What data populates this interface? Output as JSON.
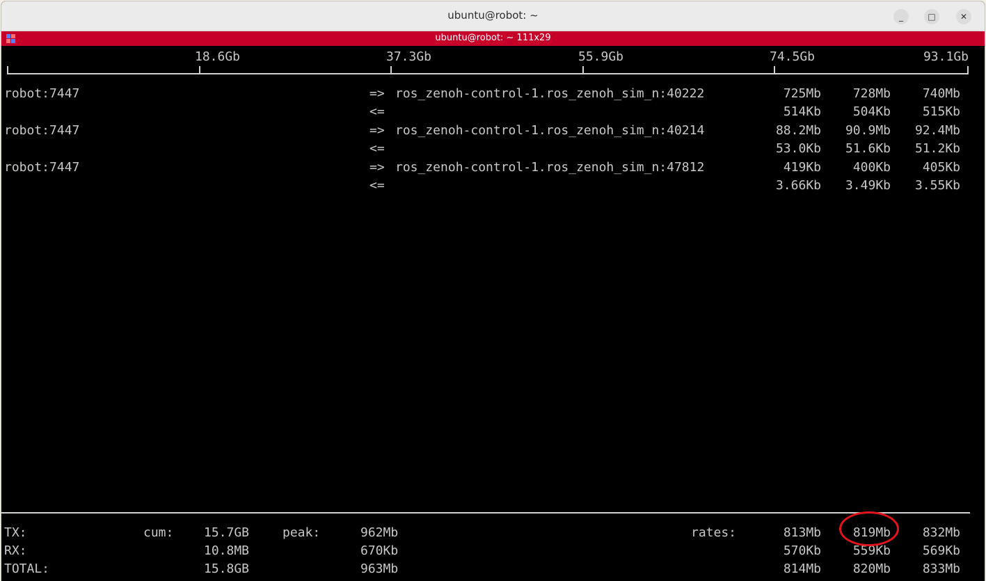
{
  "window": {
    "title": "ubuntu@robot: ~"
  },
  "tab": {
    "title": "ubuntu@robot: ~ 111x29"
  },
  "scale": {
    "ticks": [
      "18.6Gb",
      "37.3Gb",
      "55.9Gb",
      "74.5Gb",
      "93.1Gb"
    ]
  },
  "connections": [
    {
      "host": "robot:7447",
      "tx_arrow": "=>",
      "peer": "ros_zenoh-control-1.ros_zenoh_sim_n:40222",
      "tx": [
        "725Mb",
        "728Mb",
        "740Mb"
      ],
      "rx_arrow": "<=",
      "rx": [
        "514Kb",
        "504Kb",
        "515Kb"
      ]
    },
    {
      "host": "robot:7447",
      "tx_arrow": "=>",
      "peer": "ros_zenoh-control-1.ros_zenoh_sim_n:40214",
      "tx": [
        "88.2Mb",
        "90.9Mb",
        "92.4Mb"
      ],
      "rx_arrow": "<=",
      "rx": [
        "53.0Kb",
        "51.6Kb",
        "51.2Kb"
      ]
    },
    {
      "host": "robot:7447",
      "tx_arrow": "=>",
      "peer": "ros_zenoh-control-1.ros_zenoh_sim_n:47812",
      "tx": [
        "419Kb",
        "400Kb",
        "405Kb"
      ],
      "rx_arrow": "<=",
      "rx": [
        "3.66Kb",
        "3.49Kb",
        "3.55Kb"
      ]
    }
  ],
  "summary": {
    "tx_label": "TX:",
    "rx_label": "RX:",
    "total_label": "TOTAL:",
    "cum_label": "cum:",
    "peak_label": "peak:",
    "rates_label": "rates:",
    "tx": {
      "cum": "15.7GB",
      "peak": "962Mb",
      "rates": [
        "813Mb",
        "819Mb",
        "832Mb"
      ]
    },
    "rx": {
      "cum": "10.8MB",
      "peak": "670Kb",
      "rates": [
        "570Kb",
        "559Kb",
        "569Kb"
      ]
    },
    "total": {
      "cum": "15.8GB",
      "peak": "963Mb",
      "rates": [
        "814Mb",
        "820Mb",
        "833Mb"
      ]
    }
  },
  "colors": {
    "tab_bar": "#c7002a",
    "annotation_circle": "#e0141a"
  },
  "icons": [
    "terminal-tab-icon",
    "minimize-icon",
    "maximize-icon",
    "close-icon"
  ]
}
